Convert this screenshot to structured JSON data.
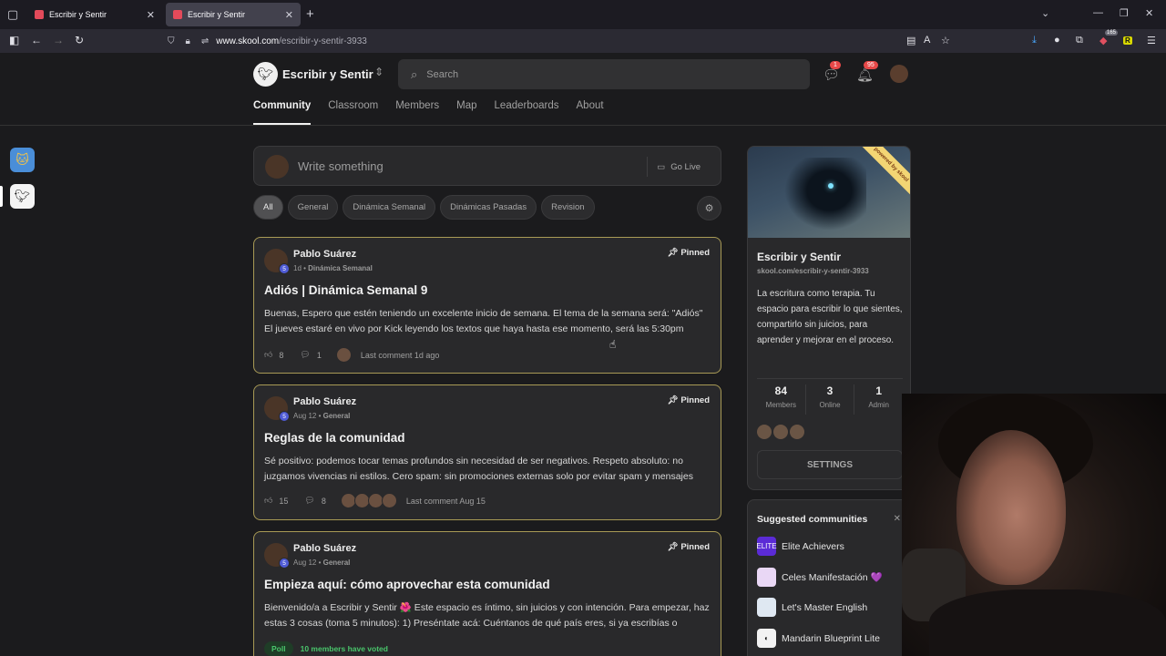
{
  "browser": {
    "tabs": [
      {
        "title": "Escribir y Sentir",
        "active": false
      },
      {
        "title": "Escribir y Sentir",
        "active": true
      }
    ],
    "url_domain": "www.skool.com",
    "url_path": "/escribir-y-sentir-3933",
    "ext_badge": "165",
    "ext_r": "R"
  },
  "header": {
    "community_name": "Escribir y Sentir",
    "search_placeholder": "Search",
    "chat_badge": "1",
    "notif_badge": "95"
  },
  "tabs": [
    "Community",
    "Classroom",
    "Members",
    "Map",
    "Leaderboards",
    "About"
  ],
  "composer": {
    "placeholder": "Write something",
    "golive": "Go Live"
  },
  "filters": [
    "All",
    "General",
    "Dinámica Semanal",
    "Dinámicas Pasadas",
    "Revision"
  ],
  "posts": [
    {
      "author": "Pablo Suárez",
      "level": "5",
      "time": "1d",
      "category": "Dinámica Semanal",
      "pinned": "Pinned",
      "title": "Adiós | Dinámica Semanal 9",
      "body": "Buenas, Espero que estén teniendo un excelente inicio de semana. El tema de la semana será: \"Adiós\" El jueves estaré en vivo por Kick leyendo los textos que haya hasta ese momento, será las 5:30pm",
      "likes": "8",
      "comments": "1",
      "last_comment": "Last comment 1d ago"
    },
    {
      "author": "Pablo Suárez",
      "level": "5",
      "time": "Aug 12",
      "category": "General",
      "pinned": "Pinned",
      "title": "Reglas de la comunidad",
      "body": "Sé positivo: podemos tocar temas profundos sin necesidad de ser negativos. Respeto absoluto: no juzgamos vivencias ni estilos. Cero spam: sin promociones externas solo por evitar spam y mensajes",
      "likes": "15",
      "comments": "8",
      "last_comment": "Last comment Aug 15"
    },
    {
      "author": "Pablo Suárez",
      "level": "5",
      "time": "Aug 12",
      "category": "General",
      "pinned": "Pinned",
      "title": "Empieza aquí: cómo aprovechar esta comunidad",
      "body": "Bienvenido/a a Escribir y Sentir 🌺 Este espacio es íntimo, sin juicios y con intención. Para empezar, haz estas 3 cosas (toma 5 minutos): 1) Preséntate acá: Cuéntanos de qué país eres, si ya escribías o",
      "poll": "Poll",
      "voted": "10 members have voted"
    }
  ],
  "about": {
    "ribbon": "powered by skool",
    "name": "Escribir y Sentir",
    "url": "skool.com/escribir-y-sentir-3933",
    "description": "La escritura como terapia. Tu espacio para escribir lo que sientes, compartirlo sin juicios, para aprender y mejorar en el proceso.",
    "stats": [
      {
        "value": "84",
        "label": "Members"
      },
      {
        "value": "3",
        "label": "Online"
      },
      {
        "value": "1",
        "label": "Admin"
      }
    ],
    "settings": "SETTINGS"
  },
  "suggested": {
    "title": "Suggested communities",
    "items": [
      {
        "name": "Elite Achievers",
        "icon_text": "ELITE",
        "color": "#5b2bd6"
      },
      {
        "name": "Celes Manifestación 💜",
        "icon_text": "",
        "color": "#e9d7f5"
      },
      {
        "name": "Let's Master English",
        "icon_text": "",
        "color": "#dfe8f2"
      },
      {
        "name": "Mandarin Blueprint Lite",
        "icon_text": "",
        "color": "#f2f2f2"
      }
    ]
  }
}
